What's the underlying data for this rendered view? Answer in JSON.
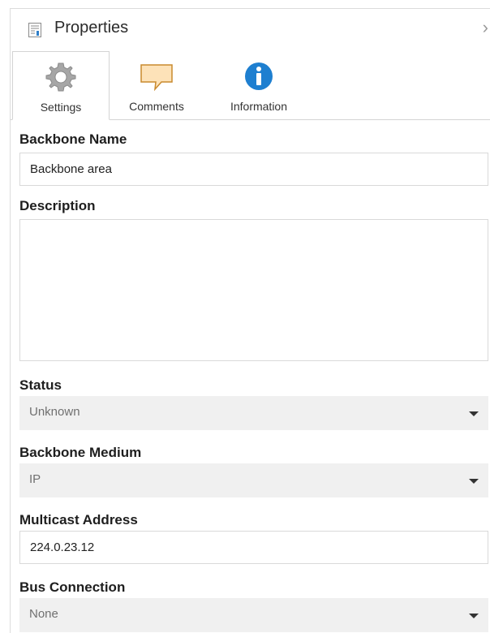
{
  "panel": {
    "title": "Properties",
    "title_icon": "properties-page-icon",
    "close_icon": "chevron-right-icon",
    "close_glyph": "›"
  },
  "tabs": [
    {
      "label": "Settings",
      "icon": "gear-icon",
      "active": true
    },
    {
      "label": "Comments",
      "icon": "speech-bubble-icon",
      "active": false
    },
    {
      "label": "Information",
      "icon": "info-icon",
      "active": false
    }
  ],
  "fields": {
    "backbone_name": {
      "label": "Backbone Name",
      "value": "Backbone area"
    },
    "description": {
      "label": "Description",
      "value": ""
    },
    "status": {
      "label": "Status",
      "value": "Unknown"
    },
    "backbone_medium": {
      "label": "Backbone Medium",
      "value": "IP"
    },
    "multicast_address": {
      "label": "Multicast Address",
      "value": "224.0.23.12"
    },
    "bus_connection": {
      "label": "Bus Connection",
      "value": "None"
    }
  },
  "colors": {
    "info_blue": "#1e7fd0",
    "comment_fill": "#fde2b8",
    "comment_stroke": "#c98a2e",
    "gear": "#9c9c9c",
    "dropdown_bg": "#f0f0f0"
  }
}
